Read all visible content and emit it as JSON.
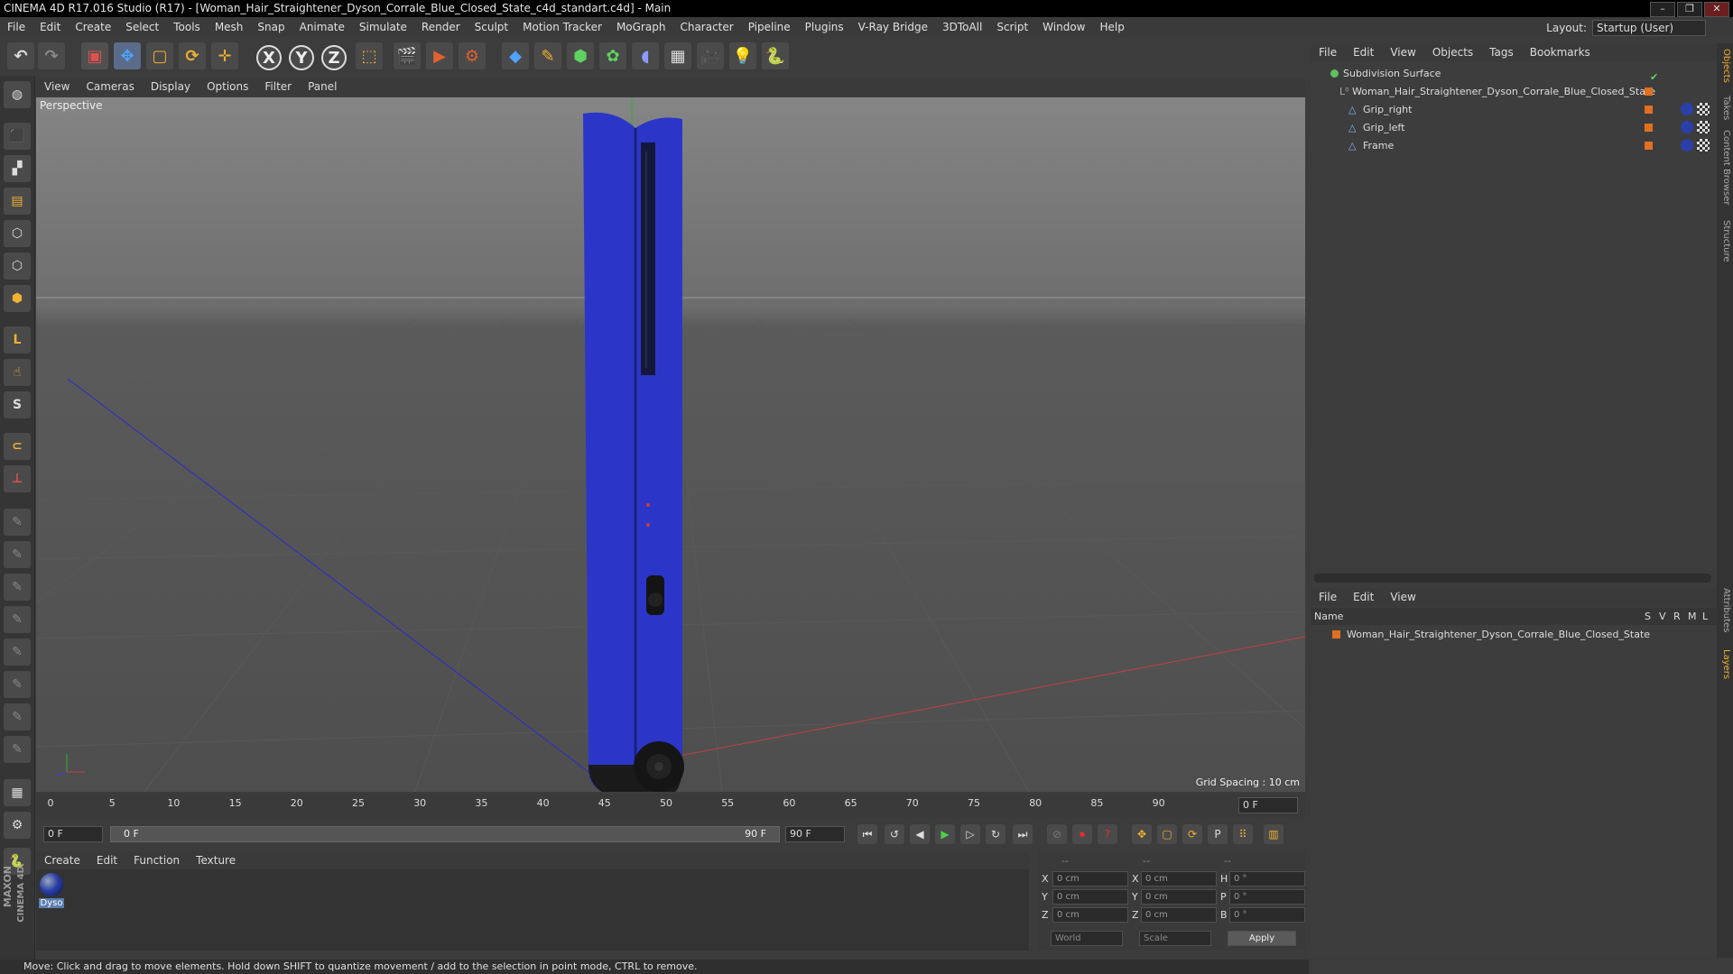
{
  "window": {
    "title": "CINEMA 4D R17.016 Studio (R17) - [Woman_Hair_Straightener_Dyson_Corrale_Blue_Closed_State_c4d_standart.c4d] - Main",
    "controls": [
      "–",
      "❐",
      "✕"
    ]
  },
  "menubar": {
    "items": [
      "File",
      "Edit",
      "Create",
      "Select",
      "Tools",
      "Mesh",
      "Snap",
      "Animate",
      "Simulate",
      "Render",
      "Sculpt",
      "Motion Tracker",
      "MoGraph",
      "Character",
      "Pipeline",
      "Plugins",
      "V-Ray Bridge",
      "3DToAll",
      "Script",
      "Window",
      "Help"
    ],
    "layout_label": "Layout:",
    "layout_value": "Startup (User)"
  },
  "viewport": {
    "menu": [
      "View",
      "Cameras",
      "Display",
      "Options",
      "Filter",
      "Panel"
    ],
    "label": "Perspective",
    "grid_spacing": "Grid Spacing : 10 cm"
  },
  "timeline": {
    "ticks": [
      "0",
      "5",
      "10",
      "15",
      "20",
      "25",
      "30",
      "35",
      "40",
      "45",
      "50",
      "55",
      "60",
      "65",
      "70",
      "75",
      "80",
      "85",
      "90"
    ],
    "frame_end": "0 F",
    "current_frame": "0 F",
    "range_start": "0 F",
    "range_end": "90 F",
    "max_frame": "90 F"
  },
  "materials": {
    "menu": [
      "Create",
      "Edit",
      "Function",
      "Texture"
    ],
    "items": [
      {
        "name": "Dyso",
        "color": "#2a3fa8"
      }
    ]
  },
  "coordinates": {
    "headers": [
      "--",
      "--",
      "--"
    ],
    "rows": [
      {
        "a": "X",
        "av": "0 cm",
        "b": "X",
        "bv": "0 cm",
        "c": "H",
        "cv": "0 °"
      },
      {
        "a": "Y",
        "av": "0 cm",
        "b": "Y",
        "bv": "0 cm",
        "c": "P",
        "cv": "0 °"
      },
      {
        "a": "Z",
        "av": "0 cm",
        "b": "Z",
        "bv": "0 cm",
        "c": "B",
        "cv": "0 °"
      }
    ],
    "space": "World",
    "mode": "Scale",
    "apply_label": "Apply"
  },
  "objects": {
    "menu": [
      "File",
      "Edit",
      "View",
      "Objects",
      "Tags",
      "Bookmarks"
    ],
    "tree": [
      {
        "name": "Subdivision Surface",
        "depth": 0,
        "color": "#5fbf5f"
      },
      {
        "name": "Woman_Hair_Straightener_Dyson_Corrale_Blue_Closed_State",
        "depth": 1,
        "color": "#e07020"
      },
      {
        "name": "Grip_right",
        "depth": 2,
        "color": "#e07020"
      },
      {
        "name": "Grip_left",
        "depth": 2,
        "color": "#e07020"
      },
      {
        "name": "Frame",
        "depth": 2,
        "color": "#e07020"
      }
    ]
  },
  "layers": {
    "menu": [
      "File",
      "Edit",
      "View"
    ],
    "columns": [
      "Name",
      "S",
      "V",
      "R",
      "M",
      "L"
    ],
    "items": [
      {
        "name": "Woman_Hair_Straightener_Dyson_Corrale_Blue_Closed_State",
        "color": "#e07020"
      }
    ]
  },
  "right_tabs": [
    "Objects",
    "Takes",
    "Content Browser",
    "Structure",
    "Attributes",
    "Layers"
  ],
  "status": "Move: Click and drag to move elements. Hold down SHIFT to quantize movement / add to the selection in point mode, CTRL to remove.",
  "brand": {
    "maxon": "MAXON",
    "cinema": "CINEMA 4D"
  },
  "accent": "#2b36c8"
}
